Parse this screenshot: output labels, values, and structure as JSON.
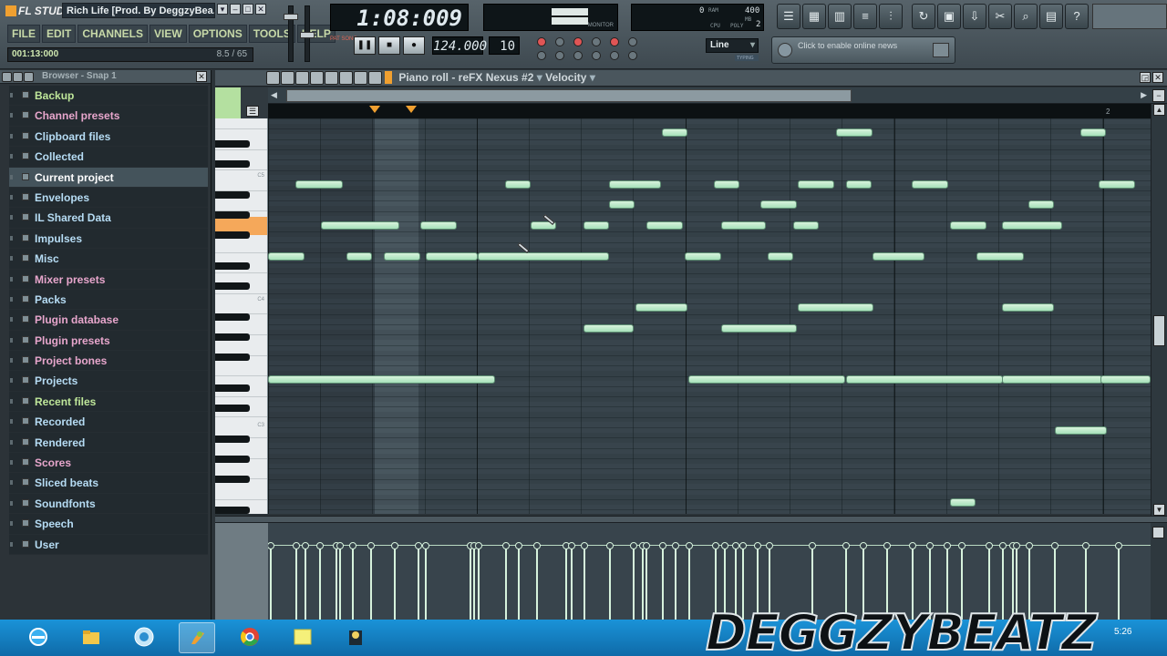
{
  "app": {
    "logo_text": "FL STUDIO",
    "title_hint": "Rich Life [Prod. By DeggzyBea...",
    "menu": [
      "FILE",
      "EDIT",
      "CHANNELS",
      "VIEW",
      "OPTIONS",
      "TOOLS",
      "HELP"
    ],
    "song_position": "001:13:000",
    "song_position_right": "8.5 / 65"
  },
  "transport": {
    "time": "1:08:009",
    "tempo": "124.000",
    "pattern": "10",
    "pat_song": "PAT SONG",
    "play_label": "❚❚",
    "stop_label": "■",
    "record_label": "●",
    "snap_value": "Line",
    "snap_strip": "TYPING"
  },
  "monitor": {
    "label": "MONITOR",
    "cpu_value": "0",
    "poly_value": "400",
    "poly_small": "2",
    "ram_label": "RAM",
    "cpu_label": "CPU",
    "poly_label": "POLY",
    "mb_label": "MB"
  },
  "news": {
    "text": "Click to enable online news"
  },
  "browser": {
    "title": "Browser - Snap 1",
    "items": [
      {
        "label": "Backup",
        "color": "green"
      },
      {
        "label": "Channel presets",
        "color": "pink"
      },
      {
        "label": "Clipboard files",
        "color": "blue"
      },
      {
        "label": "Collected",
        "color": "blue"
      },
      {
        "label": "Current project",
        "color": "white",
        "selected": true
      },
      {
        "label": "Envelopes",
        "color": "blue"
      },
      {
        "label": "IL Shared Data",
        "color": "blue"
      },
      {
        "label": "Impulses",
        "color": "blue"
      },
      {
        "label": "Misc",
        "color": "blue"
      },
      {
        "label": "Mixer presets",
        "color": "pink"
      },
      {
        "label": "Packs",
        "color": "blue"
      },
      {
        "label": "Plugin database",
        "color": "pink"
      },
      {
        "label": "Plugin presets",
        "color": "pink"
      },
      {
        "label": "Project bones",
        "color": "pink"
      },
      {
        "label": "Projects",
        "color": "blue"
      },
      {
        "label": "Recent files",
        "color": "green"
      },
      {
        "label": "Recorded",
        "color": "blue"
      },
      {
        "label": "Rendered",
        "color": "blue"
      },
      {
        "label": "Scores",
        "color": "pink"
      },
      {
        "label": "Sliced beats",
        "color": "blue"
      },
      {
        "label": "Soundfonts",
        "color": "blue"
      },
      {
        "label": "Speech",
        "color": "blue"
      },
      {
        "label": "User",
        "color": "blue"
      }
    ]
  },
  "piano_roll": {
    "title": "Piano roll - reFX Nexus #2",
    "target": "Velocity",
    "ruler_marker": "2",
    "octave_marks": [
      "C5",
      "C4",
      "C3"
    ]
  },
  "taskbar": {
    "watermark": "DEGGZYBEATZ",
    "clock": "5:26"
  },
  "colors": {
    "note_fill": "#c6ecd0",
    "accent_orange": "#f0a030",
    "taskbar_blue": "#1a93d8"
  }
}
